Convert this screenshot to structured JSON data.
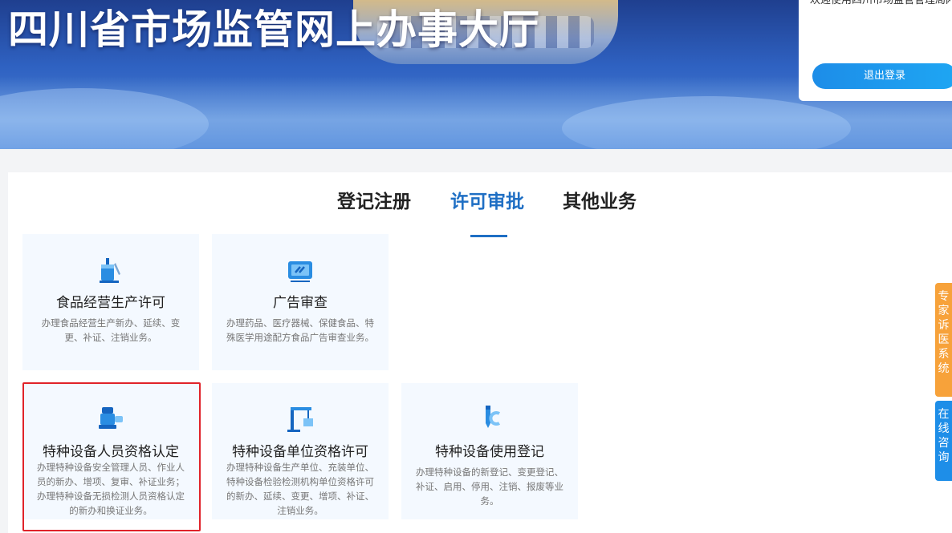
{
  "header": {
    "title": "四川省市场监管网上办事大厅",
    "welcome_text": "欢迎使用四川市场监管管理局网上办事大厅系统",
    "logout_label": "退出登录"
  },
  "tabs": [
    {
      "label": "登记注册",
      "active": false
    },
    {
      "label": "许可审批",
      "active": true
    },
    {
      "label": "其他业务",
      "active": false
    }
  ],
  "cards": [
    {
      "icon": "cup-icon",
      "title": "食品经营生产许可",
      "desc": "办理食品经营生产新办、延续、变更、补证、注销业务。"
    },
    {
      "icon": "ad-screen-icon",
      "title": "广告审查",
      "desc": "办理药品、医疗器械、保健食品、特殊医学用途配方食品广告审查业务。"
    },
    {
      "icon": "machine-operator-icon",
      "title": "特种设备人员资格认定",
      "desc": "办理特种设备安全管理人员、作业人员的新办、增项、复审、补证业务；办理特种设备无损检测人员资格认定的新办和换证业务。"
    },
    {
      "icon": "crane-icon",
      "title": "特种设备单位资格许可",
      "desc": "办理特种设备生产单位、充装单位、特种设备检验检测机构单位资格许可的新办、延续、变更、增项、补证、注销业务。"
    },
    {
      "icon": "pen-register-icon",
      "title": "特种设备使用登记",
      "desc": "办理特种设备的新登记、变更登记、补证、启用、停用、注销、报废等业务。"
    }
  ],
  "side_tabs": [
    {
      "label": "专家诉医系统",
      "color": "#f7a23a"
    },
    {
      "label": "在线咨询",
      "color": "#1e8ee8"
    }
  ]
}
